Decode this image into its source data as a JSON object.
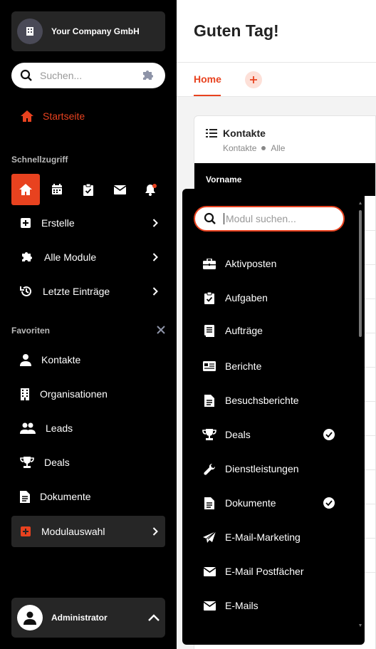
{
  "sidebar": {
    "company": "Your Company GmbH",
    "search_placeholder": "Suchen...",
    "start": "Startseite",
    "quick_access_title": "Schnellzugriff",
    "quick_icons": [
      "home-icon",
      "calendar-icon",
      "clipboard-check-icon",
      "mail-icon",
      "bell-icon"
    ],
    "nav": [
      {
        "label": "Erstelle",
        "icon": "plus-square-icon"
      },
      {
        "label": "Alle Module",
        "icon": "puzzle-icon"
      },
      {
        "label": "Letzte Einträge",
        "icon": "history-icon"
      }
    ],
    "favorites_title": "Favoriten",
    "favorites": [
      {
        "label": "Kontakte",
        "icon": "user-icon"
      },
      {
        "label": "Organisationen",
        "icon": "building-icon"
      },
      {
        "label": "Leads",
        "icon": "users-icon"
      },
      {
        "label": "Deals",
        "icon": "trophy-icon"
      },
      {
        "label": "Dokumente",
        "icon": "document-icon"
      }
    ],
    "module_select": "Modulauswahl",
    "user": "Administrator"
  },
  "main": {
    "greeting": "Guten Tag!",
    "tab_home": "Home",
    "card": {
      "title": "Kontakte",
      "sub_module": "Kontakte",
      "sub_filter": "Alle",
      "column_header": "Vorname"
    }
  },
  "module_dropdown": {
    "search_placeholder": "Modul suchen...",
    "items": [
      {
        "label": "Aktivposten",
        "icon": "briefcase-icon",
        "checked": false
      },
      {
        "label": "Aufgaben",
        "icon": "clipboard-check-icon",
        "checked": false
      },
      {
        "label": "Aufträge",
        "icon": "order-icon",
        "checked": false
      },
      {
        "label": "Berichte",
        "icon": "report-icon",
        "checked": false
      },
      {
        "label": "Besuchsberichte",
        "icon": "document-icon",
        "checked": false
      },
      {
        "label": "Deals",
        "icon": "trophy-icon",
        "checked": true
      },
      {
        "label": "Dienstleistungen",
        "icon": "wrench-icon",
        "checked": false
      },
      {
        "label": "Dokumente",
        "icon": "document-icon",
        "checked": true
      },
      {
        "label": "E-Mail-Marketing",
        "icon": "paper-plane-icon",
        "checked": false
      },
      {
        "label": "E-Mail Postfächer",
        "icon": "mail-icon",
        "checked": false
      },
      {
        "label": "E-Mails",
        "icon": "mail-icon",
        "checked": false
      }
    ]
  },
  "colors": {
    "accent": "#e8421f",
    "sidebar_bg": "#000000",
    "sidebar_panel": "#262626"
  }
}
